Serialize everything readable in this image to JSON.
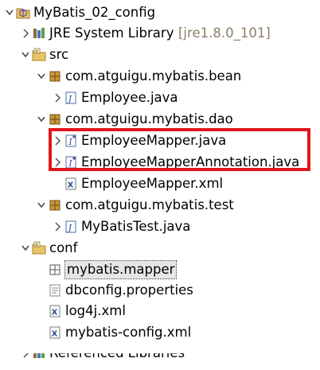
{
  "tree": [
    {
      "id": "proj",
      "label": "MyBatis_02_config",
      "decoration": "",
      "icon": "project-icon",
      "expanded": true
    },
    {
      "id": "jre",
      "label": "JRE System Library",
      "decoration": "[jre1.8.0_101]",
      "icon": "library-icon",
      "expanded": false
    },
    {
      "id": "src",
      "label": "src",
      "decoration": "",
      "icon": "source-folder-icon",
      "expanded": true
    },
    {
      "id": "pkg_bean",
      "label": "com.atguigu.mybatis.bean",
      "decoration": "",
      "icon": "package-icon",
      "expanded": true
    },
    {
      "id": "employee",
      "label": "Employee.java",
      "decoration": "",
      "icon": "java-file-icon",
      "expanded": false
    },
    {
      "id": "pkg_dao",
      "label": "com.atguigu.mybatis.dao",
      "decoration": "",
      "icon": "package-icon",
      "expanded": true
    },
    {
      "id": "mapper",
      "label": "EmployeeMapper.java",
      "decoration": "",
      "icon": "java-interface-icon",
      "expanded": false
    },
    {
      "id": "mapper_anno",
      "label": "EmployeeMapperAnnotation.java",
      "decoration": "",
      "icon": "java-interface-icon",
      "expanded": false
    },
    {
      "id": "mapper_xml",
      "label": "EmployeeMapper.xml",
      "decoration": "",
      "icon": "xml-file-icon",
      "expanded": null
    },
    {
      "id": "pkg_test",
      "label": "com.atguigu.mybatis.test",
      "decoration": "",
      "icon": "package-icon",
      "expanded": true
    },
    {
      "id": "test",
      "label": "MyBatisTest.java",
      "decoration": "",
      "icon": "java-file-icon",
      "expanded": false
    },
    {
      "id": "conf",
      "label": "conf",
      "decoration": "",
      "icon": "source-folder-icon",
      "expanded": true
    },
    {
      "id": "mapper_pkg",
      "label": "mybatis.mapper",
      "decoration": "",
      "icon": "empty-package-icon",
      "expanded": null,
      "selected": true
    },
    {
      "id": "dbconfig",
      "label": "dbconfig.properties",
      "decoration": "",
      "icon": "properties-file-icon",
      "expanded": null
    },
    {
      "id": "log4j",
      "label": "log4j.xml",
      "decoration": "",
      "icon": "xml-file-icon",
      "expanded": null
    },
    {
      "id": "mybatis_config",
      "label": "mybatis-config.xml",
      "decoration": "",
      "icon": "xml-file-icon",
      "expanded": null
    },
    {
      "id": "reflibs",
      "label": "Referenced Libraries",
      "decoration": "",
      "icon": "library-icon",
      "expanded": false
    }
  ],
  "colors": {
    "highlight": "#e1151d",
    "decoration": "#8a7f66",
    "selection": "#e6e6e6"
  }
}
